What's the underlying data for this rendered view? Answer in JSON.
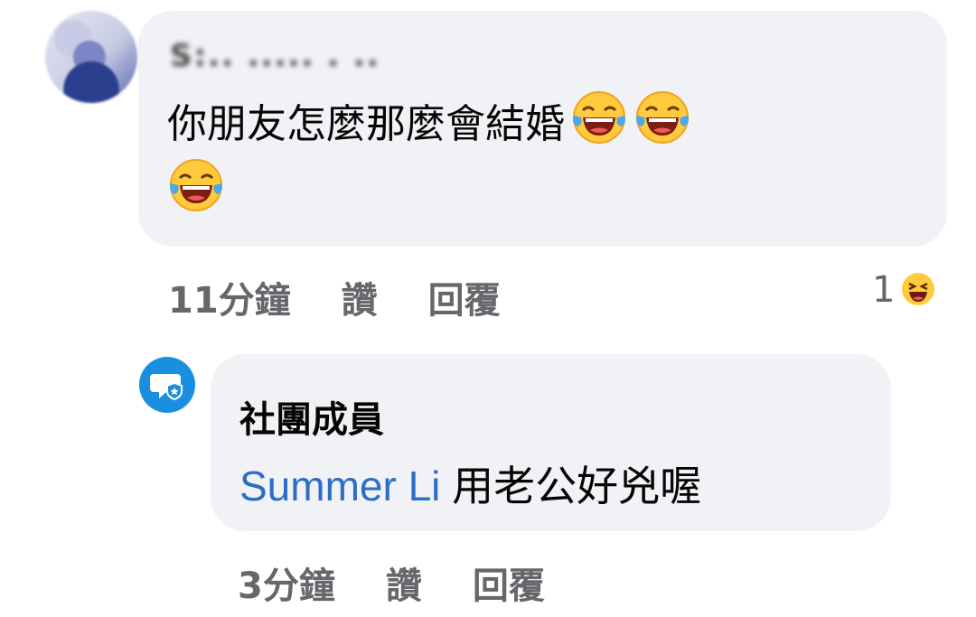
{
  "comment1": {
    "author": "S:.. ..... . ..",
    "text": "你朋友怎麼那麼會結婚",
    "emoji_count": 3,
    "meta": {
      "time": "11分鐘",
      "like": "讚",
      "reply": "回覆"
    },
    "reaction": {
      "count": "1",
      "icon": "laughing-emoji"
    }
  },
  "comment2": {
    "badge_icon": "group-member-badge",
    "author": "社團成員",
    "mention": "Summer Li",
    "text": "用老公好兇喔",
    "meta": {
      "time": "3分鐘",
      "like": "讚",
      "reply": "回覆"
    }
  },
  "colors": {
    "bubble": "#f0f2f5",
    "meta_text": "#65676b",
    "mention": "#2d6ec5",
    "badge": "#1a8fe0"
  }
}
